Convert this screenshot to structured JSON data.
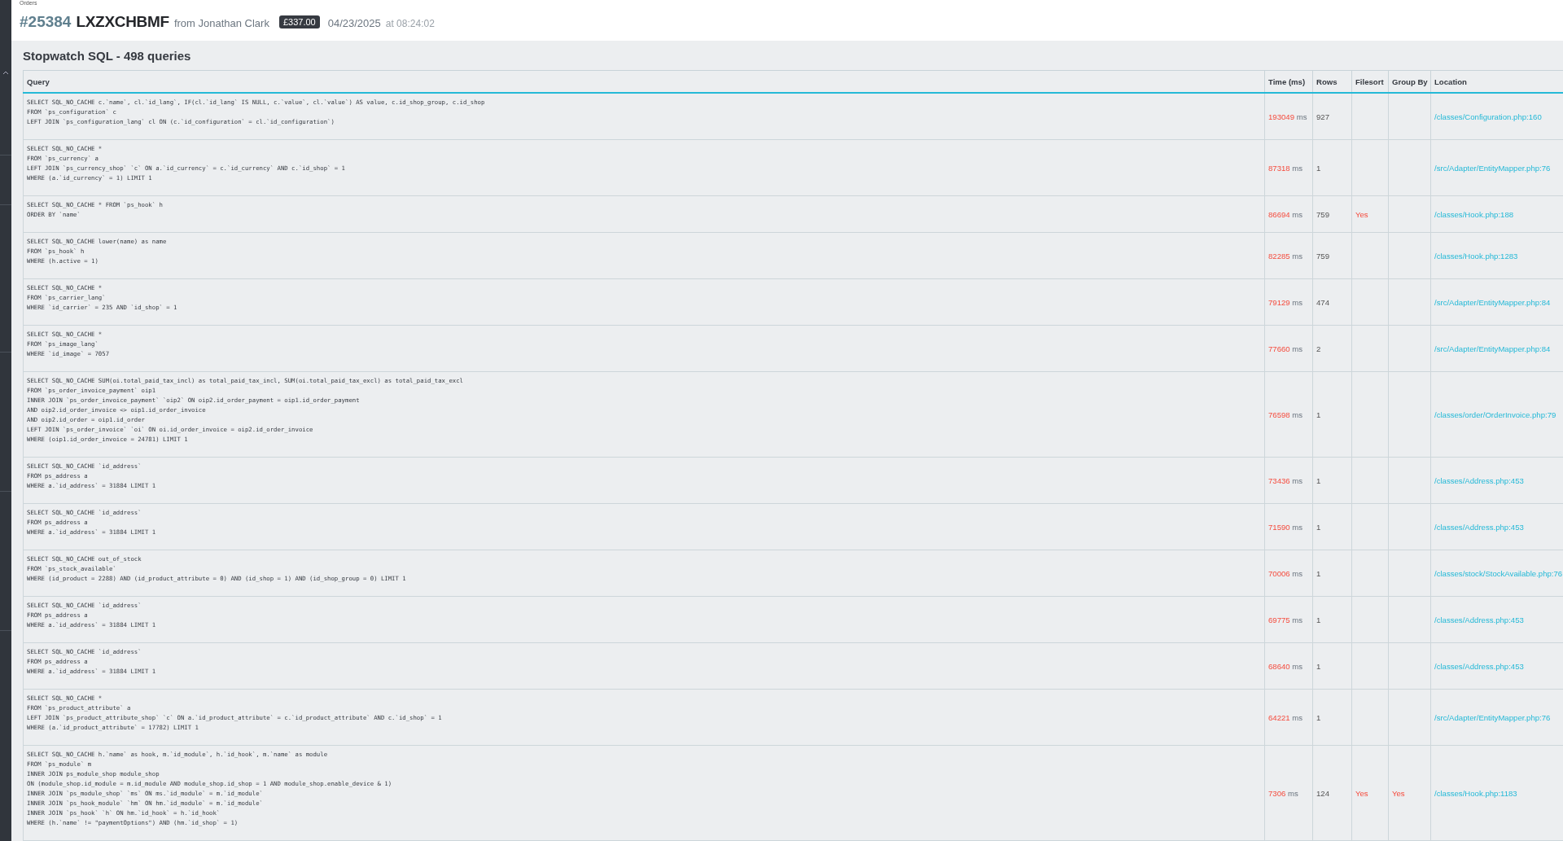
{
  "breadcrumb": "Orders",
  "order": {
    "number": "#25384",
    "reference": "LXZXCHBMF",
    "customer": "from Jonathan Clark",
    "total": "£337.00",
    "date": "04/23/2025",
    "time": "at 08:24:02"
  },
  "section_title": "Stopwatch SQL - 498 queries",
  "table": {
    "columns": [
      "Query",
      "Time (ms)",
      "Rows",
      "Filesort",
      "Group By",
      "Location"
    ],
    "rows": [
      {
        "query": "SELECT SQL_NO_CACHE c.`name`, cl.`id_lang`, IF(cl.`id_lang` IS NULL, c.`value`, cl.`value`) AS value, c.id_shop_group, c.id_shop\nFROM `ps_configuration` c\nLEFT JOIN `ps_configuration_lang` cl ON (c.`id_configuration` = cl.`id_configuration`)",
        "time": "193049",
        "unit": "ms",
        "rows": "927",
        "location": "/classes/Configuration.php:160"
      },
      {
        "query": "SELECT SQL_NO_CACHE *\nFROM `ps_currency` a\nLEFT JOIN `ps_currency_shop` `c` ON a.`id_currency` = c.`id_currency` AND c.`id_shop` = 1\nWHERE (a.`id_currency` = 1) LIMIT 1",
        "time": "87318",
        "unit": "ms",
        "rows": "1",
        "location": "/src/Adapter/EntityMapper.php:76"
      },
      {
        "query": "SELECT SQL_NO_CACHE * FROM `ps_hook` h\nORDER BY `name`",
        "time": "86694",
        "unit": "ms",
        "rows": "759",
        "filesort": "Yes",
        "location": "/classes/Hook.php:188"
      },
      {
        "query": "SELECT SQL_NO_CACHE lower(name) as name\nFROM `ps_hook` h\nWHERE (h.active = 1)",
        "time": "82285",
        "unit": "ms",
        "rows": "759",
        "location": "/classes/Hook.php:1283"
      },
      {
        "query": "SELECT SQL_NO_CACHE *\nFROM `ps_carrier_lang`\nWHERE `id_carrier` = 235 AND `id_shop` = 1",
        "time": "79129",
        "unit": "ms",
        "rows": "474",
        "location": "/src/Adapter/EntityMapper.php:84"
      },
      {
        "query": "SELECT SQL_NO_CACHE *\nFROM `ps_image_lang`\nWHERE `id_image` = 7057",
        "time": "77660",
        "unit": "ms",
        "rows": "2",
        "location": "/src/Adapter/EntityMapper.php:84"
      },
      {
        "query": "SELECT SQL_NO_CACHE SUM(oi.total_paid_tax_incl) as total_paid_tax_incl, SUM(oi.total_paid_tax_excl) as total_paid_tax_excl\nFROM `ps_order_invoice_payment` oip1\nINNER JOIN `ps_order_invoice_payment` `oip2` ON oip2.id_order_payment = oip1.id_order_payment\nAND oip2.id_order_invoice <> oip1.id_order_invoice\nAND oip2.id_order = oip1.id_order\nLEFT JOIN `ps_order_invoice` `oi` ON oi.id_order_invoice = oip2.id_order_invoice\nWHERE (oip1.id_order_invoice = 24781) LIMIT 1",
        "time": "76598",
        "unit": "ms",
        "rows": "1",
        "location": "/classes/order/OrderInvoice.php:79"
      },
      {
        "query": "SELECT SQL_NO_CACHE `id_address`\nFROM ps_address a\nWHERE a.`id_address` = 31884 LIMIT 1",
        "time": "73436",
        "unit": "ms",
        "rows": "1",
        "location": "/classes/Address.php:453"
      },
      {
        "query": "SELECT SQL_NO_CACHE `id_address`\nFROM ps_address a\nWHERE a.`id_address` = 31884 LIMIT 1",
        "time": "71590",
        "unit": "ms",
        "rows": "1",
        "location": "/classes/Address.php:453"
      },
      {
        "query": "SELECT SQL_NO_CACHE out_of_stock\nFROM `ps_stock_available`\nWHERE (id_product = 2288) AND (id_product_attribute = 0) AND (id_shop = 1) AND (id_shop_group = 0) LIMIT 1",
        "time": "70006",
        "unit": "ms",
        "rows": "1",
        "location": "/classes/stock/StockAvailable.php:76"
      },
      {
        "query": "SELECT SQL_NO_CACHE `id_address`\nFROM ps_address a\nWHERE a.`id_address` = 31884 LIMIT 1",
        "time": "69775",
        "unit": "ms",
        "rows": "1",
        "location": "/classes/Address.php:453"
      },
      {
        "query": "SELECT SQL_NO_CACHE `id_address`\nFROM ps_address a\nWHERE a.`id_address` = 31884 LIMIT 1",
        "time": "68640",
        "unit": "ms",
        "rows": "1",
        "location": "/classes/Address.php:453"
      },
      {
        "query": "SELECT SQL_NO_CACHE *\nFROM `ps_product_attribute` a\nLEFT JOIN `ps_product_attribute_shop` `c` ON a.`id_product_attribute` = c.`id_product_attribute` AND c.`id_shop` = 1\nWHERE (a.`id_product_attribute` = 17782) LIMIT 1",
        "time": "64221",
        "unit": "ms",
        "rows": "1",
        "location": "/src/Adapter/EntityMapper.php:76"
      },
      {
        "query": "SELECT SQL_NO_CACHE h.`name` as hook, m.`id_module`, h.`id_hook`, m.`name` as module\nFROM `ps_module` m\nINNER JOIN ps_module_shop module_shop\nON (module_shop.id_module = m.id_module AND module_shop.id_shop = 1 AND module_shop.enable_device & 1)\nINNER JOIN `ps_module_shop` `ms` ON ms.`id_module` = m.`id_module`\nINNER JOIN `ps_hook_module` `hm` ON hm.`id_module` = m.`id_module`\nINNER JOIN `ps_hook` `h` ON hm.`id_hook` = h.`id_hook`\nWHERE (h.`name` != \"paymentOptions\") AND (hm.`id_shop` = 1)",
        "time": "7306",
        "unit": "ms",
        "rows": "124",
        "filesort": "Yes",
        "group_by": "Yes",
        "location": "/classes/Hook.php:1183"
      }
    ]
  }
}
